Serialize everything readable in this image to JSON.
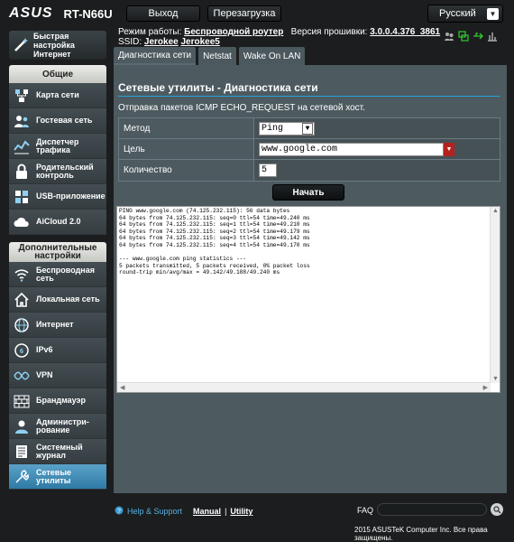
{
  "header": {
    "brand": "ASUS",
    "model": "RT-N66U",
    "logout_label": "Выход",
    "reboot_label": "Перезагрузка",
    "language": "Русский",
    "mode_label": "Режим работы:",
    "mode_value": "Беспроводной роутер",
    "firmware_label": "Версия прошивки:",
    "firmware_value": "3.0.0.4.376_3861",
    "ssid_label": "SSID:",
    "ssid_1": "Jerokee",
    "ssid_2": "Jerokee5"
  },
  "sidebar": {
    "quick_setup": "Быстрая настройка Интернет",
    "general_title": "Общие",
    "general_items": [
      {
        "label": "Карта сети",
        "icon": "network-map-icon"
      },
      {
        "label": "Гостевая сеть",
        "icon": "guest-network-icon"
      },
      {
        "label": "Диспетчер трафика",
        "icon": "traffic-manager-icon"
      },
      {
        "label": "Родительский контроль",
        "icon": "parental-control-icon"
      },
      {
        "label": "USB-приложение",
        "icon": "usb-icon"
      },
      {
        "label": "AiCloud 2.0",
        "icon": "cloud-icon"
      }
    ],
    "advanced_title": "Дополнительные настройки",
    "advanced_items": [
      {
        "label": "Беспроводная сеть",
        "icon": "wireless-icon"
      },
      {
        "label": "Локальная сеть",
        "icon": "home-icon"
      },
      {
        "label": "Интернет",
        "icon": "globe-icon"
      },
      {
        "label": "IPv6",
        "icon": "ipv6-icon"
      },
      {
        "label": "VPN",
        "icon": "vpn-icon"
      },
      {
        "label": "Брандмауэр",
        "icon": "firewall-icon"
      },
      {
        "label": "Администри-рование",
        "icon": "admin-icon"
      },
      {
        "label": "Системный журнал",
        "icon": "syslog-icon"
      },
      {
        "label": "Сетевые утилиты",
        "icon": "tools-icon"
      }
    ]
  },
  "tabs": [
    "Диагностика сети",
    "Netstat",
    "Wake On LAN"
  ],
  "page": {
    "title": "Сетевые утилиты - Диагностика сети",
    "description": "Отправка пакетов ICMP ECHO_REQUEST на сетевой хост.",
    "method_label": "Метод",
    "method_value": "Ping",
    "target_label": "Цель",
    "target_value": "www.google.com",
    "count_label": "Количество",
    "count_value": "5",
    "start_label": "Начать"
  },
  "output": "PING www.google.com (74.125.232.115): 56 data bytes\n64 bytes from 74.125.232.115: seq=0 ttl=54 time=49.240 ms\n64 bytes from 74.125.232.115: seq=1 ttl=54 time=49.210 ms\n64 bytes from 74.125.232.115: seq=2 ttl=54 time=49.179 ms\n64 bytes from 74.125.232.115: seq=3 ttl=54 time=49.142 ms\n64 bytes from 74.125.232.115: seq=4 ttl=54 time=49.170 ms\n\n--- www.google.com ping statistics ---\n5 packets transmitted, 5 packets received, 0% packet loss\nround-trip min/avg/max = 49.142/49.188/49.240 ms",
  "footer": {
    "help": "Help & Support",
    "manual": "Manual",
    "utility": "Utility",
    "faq": "FAQ",
    "copyright": "2015 ASUSTeK Computer Inc. Все права защищены."
  },
  "colors": {
    "accent": "#26a3da",
    "active_menu": "#3f8db8",
    "panel": "#4d5a60",
    "danger": "#b3221f"
  }
}
